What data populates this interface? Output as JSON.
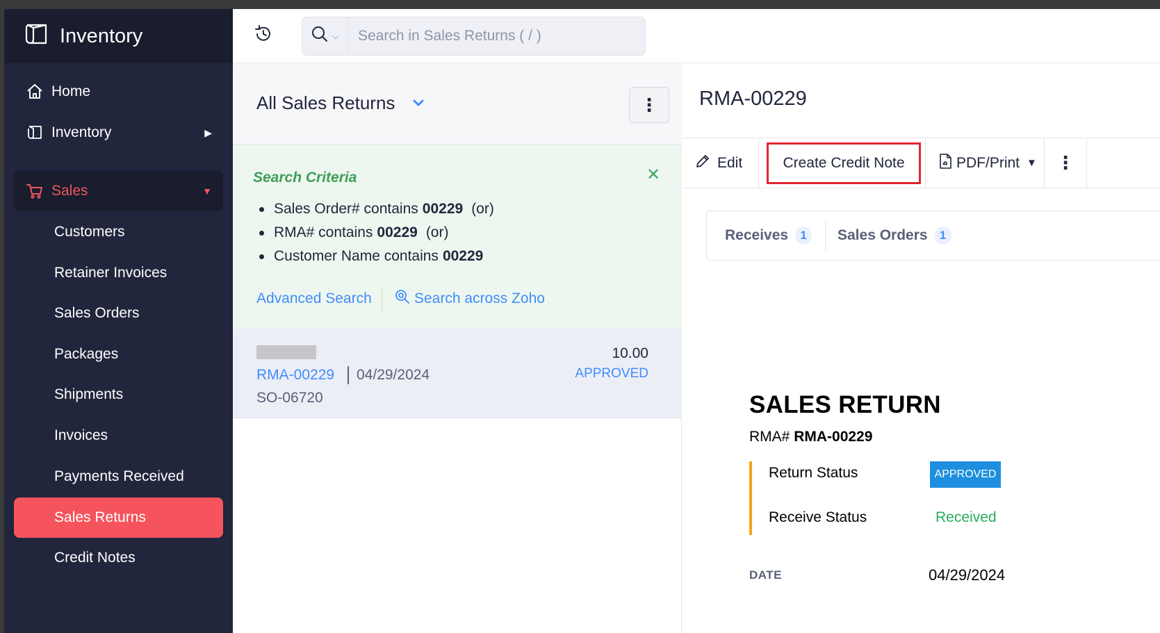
{
  "app": {
    "brand": "Inventory"
  },
  "sidebar": {
    "items": [
      {
        "label": "Home",
        "icon": "home-icon"
      },
      {
        "label": "Inventory",
        "icon": "inventory-icon"
      },
      {
        "label": "Sales",
        "icon": "cart-icon"
      }
    ],
    "sales_sub": [
      {
        "label": "Customers"
      },
      {
        "label": "Retainer Invoices"
      },
      {
        "label": "Sales Orders"
      },
      {
        "label": "Packages"
      },
      {
        "label": "Shipments"
      },
      {
        "label": "Invoices"
      },
      {
        "label": "Payments Received"
      },
      {
        "label": "Sales Returns"
      },
      {
        "label": "Credit Notes"
      }
    ],
    "active_item": "Sales Returns",
    "accent_color": "#f5545c"
  },
  "search": {
    "placeholder": "Search in Sales Returns ( / )"
  },
  "list": {
    "title": "All Sales Returns",
    "criteria": {
      "title": "Search Criteria",
      "items": [
        {
          "field": "Sales Order# contains",
          "value": "00229",
          "suffix": "(or)"
        },
        {
          "field": "RMA# contains",
          "value": "00229",
          "suffix": "(or)"
        },
        {
          "field": "Customer Name contains",
          "value": "00229",
          "suffix": ""
        }
      ],
      "advanced_search": "Advanced Search",
      "search_across": "Search across Zoho"
    },
    "rows": [
      {
        "rma": "RMA-00229",
        "date": "04/29/2024",
        "so": "SO-06720",
        "amount": "10.00",
        "status": "APPROVED"
      }
    ]
  },
  "detail": {
    "title": "RMA-00229",
    "toolbar": {
      "edit": "Edit",
      "create_credit_note": "Create Credit Note",
      "pdf_print": "PDF/Print"
    },
    "tabs": [
      {
        "label": "Receives",
        "count": "1"
      },
      {
        "label": "Sales Orders",
        "count": "1"
      }
    ],
    "document": {
      "heading": "SALES RETURN",
      "rma_label": "RMA#",
      "rma_value": "RMA-00229",
      "return_status_label": "Return Status",
      "return_status_value": "APPROVED",
      "receive_status_label": "Receive Status",
      "receive_status_value": "Received",
      "date_label": "DATE",
      "date_value": "04/29/2024"
    }
  }
}
